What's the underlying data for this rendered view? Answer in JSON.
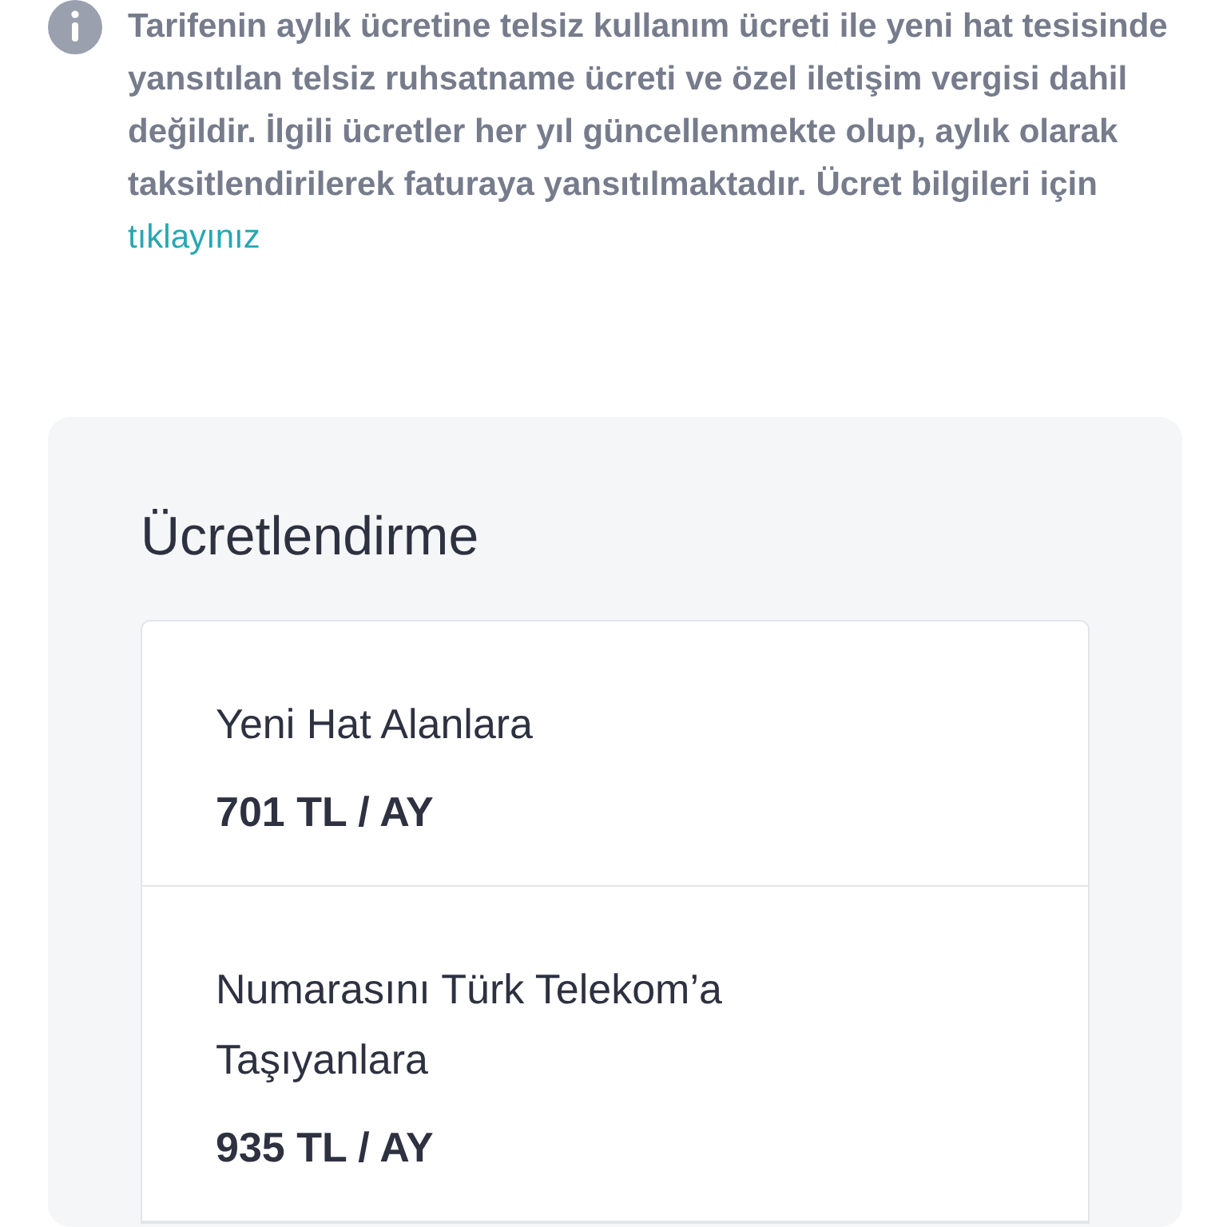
{
  "notice": {
    "text": "Tarifenin aylık ücretine telsiz kullanım ücreti ile yeni hat tesisinde yansıtılan telsiz ruhsatname ücreti ve özel iletişim vergisi dahil değildir. İlgili ücretler her yıl güncellenmekte olup, aylık olarak taksitlendirilerek faturaya yansıtılmaktadır. Ücret bilgileri için",
    "link": "tıklayınız"
  },
  "pricing": {
    "title": "Ücretlendirme",
    "items": [
      {
        "label": "Yeni Hat Alanlara",
        "price": "701 TL / AY"
      },
      {
        "label": "Numarasını Türk Telekom’a Taşıyanlara",
        "price": "935 TL / AY"
      }
    ]
  }
}
